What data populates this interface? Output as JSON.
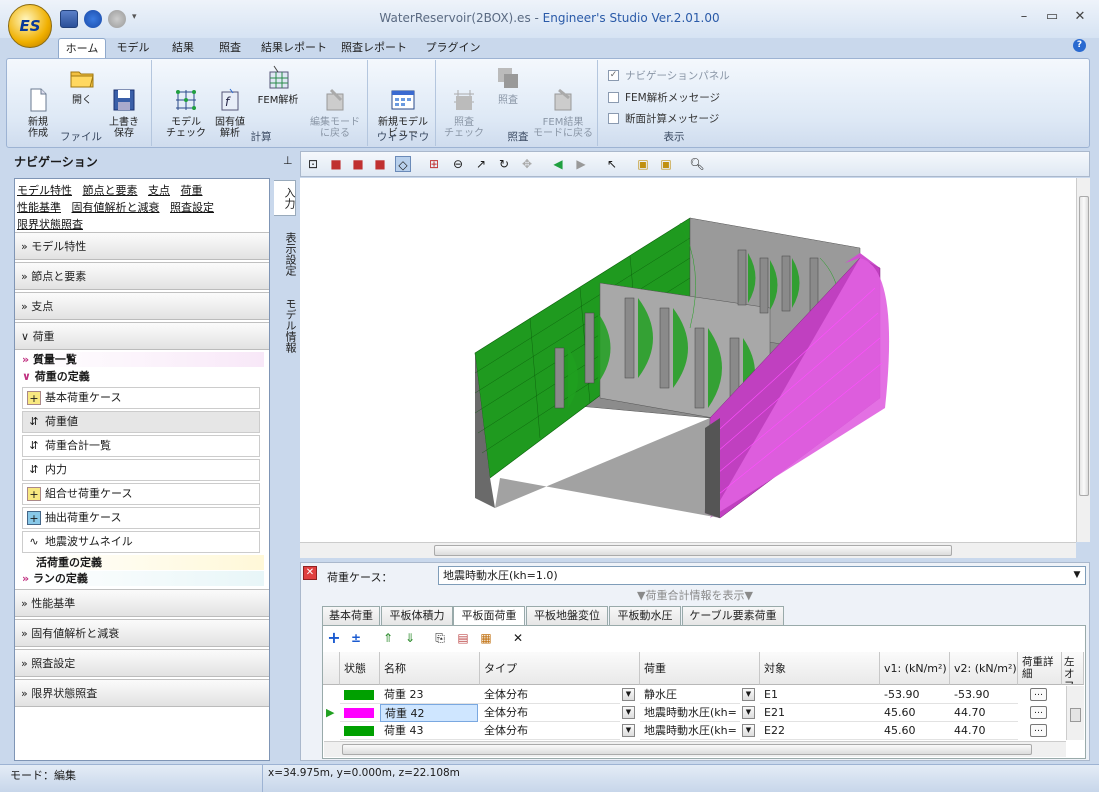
{
  "app": {
    "title_file": "WaterReservoir(2BOX).es - ",
    "title_app": "Engineer's Studio Ver.2.01.00",
    "orb_label": "ES"
  },
  "ribbon_tabs": [
    "ホーム",
    "モデル",
    "結果",
    "照査",
    "結果レポート",
    "照査レポート",
    "プラグイン"
  ],
  "ribbon": {
    "file": {
      "label": "ファイル",
      "new": "新規\n作成",
      "open": "開く",
      "save": "上書き\n保存"
    },
    "calc": {
      "label": "計算",
      "model_check": "モデル\nチェック",
      "eigen": "固有値\n解析",
      "fem": "FEM解析",
      "edit_mode": "編集モード\nに戻る"
    },
    "window": {
      "label": "ウィンドウ",
      "new_view": "新規モデル\nビュー"
    },
    "check": {
      "label": "照査",
      "check_check": "照査\nチェック",
      "check": "照査",
      "back_fem": "FEM結果\nモードに戻る"
    },
    "display": {
      "label": "表示",
      "nav_panel": "ナビゲーションパネル",
      "fem_msg": "FEM解析メッセージ",
      "section_msg": "断面計算メッセージ"
    }
  },
  "nav": {
    "title": "ナビゲーション",
    "links": [
      "モデル特性",
      "節点と要素",
      "支点",
      "荷重",
      "性能基準",
      "固有値解析と減衰",
      "照査設定",
      "限界状態照査"
    ],
    "sections_top": [
      "モデル特性",
      "節点と要素",
      "支点",
      "荷重"
    ],
    "sub_mass": "質量一覧",
    "sub_load_def": "荷重の定義",
    "items": [
      "基本荷重ケース",
      "荷重値",
      "荷重合計一覧",
      "内力",
      "組合せ荷重ケース",
      "抽出荷重ケース",
      "地震波サムネイル"
    ],
    "sub_live": "活荷重の定義",
    "sub_run": "ランの定義",
    "sections_bottom": [
      "性能基準",
      "固有値解析と減衰",
      "照査設定",
      "限界状態照査"
    ]
  },
  "vtabs": [
    "入力",
    "表示設定",
    "モデル情報"
  ],
  "load_panel": {
    "case_label": "荷重ケース：",
    "case_value": "地震時動水圧(kh=1.0)",
    "summary_toggle": "▼荷重合計情報を表示▼",
    "tabs": [
      "基本荷重",
      "平板体積力",
      "平板面荷重",
      "平板地盤変位",
      "平板動水圧",
      "ケーブル要素荷重"
    ],
    "columns": [
      "状態",
      "名称",
      "タイプ",
      "荷重",
      "対象",
      "v1: (kN/m²)",
      "v2: (kN/m²)",
      "荷重詳細",
      "左オフセ"
    ],
    "rows": [
      {
        "color": "#00a000",
        "name": "荷重 23",
        "type": "全体分布",
        "load": "静水圧",
        "target": "E1",
        "v1": "-53.90",
        "v2": "-53.90",
        "detail": "…"
      },
      {
        "color": "#ff00ff",
        "name": "荷重 42",
        "type": "全体分布",
        "load": "地震時動水圧(kh=",
        "target": "E21",
        "v1": "45.60",
        "v2": "44.70",
        "detail": "…"
      },
      {
        "color": "#00a000",
        "name": "荷重 43",
        "type": "全体分布",
        "load": "地震時動水圧(kh=",
        "target": "E22",
        "v1": "45.60",
        "v2": "44.70",
        "detail": "…"
      }
    ]
  },
  "status": {
    "mode": "モード：編集",
    "coords": "x=34.975m, y=0.000m, z=22.108m"
  }
}
